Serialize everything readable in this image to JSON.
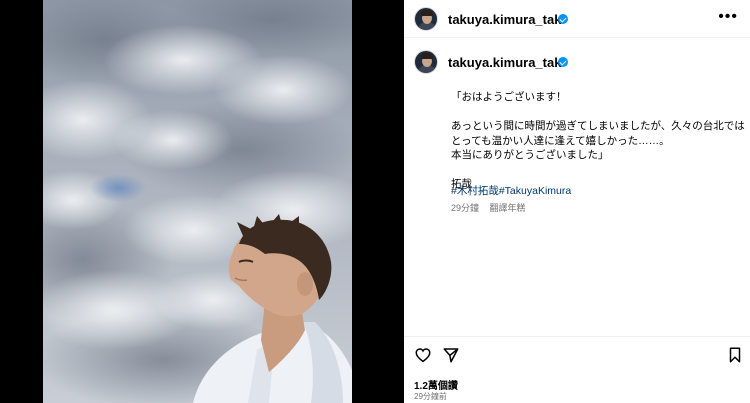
{
  "post": {
    "username": "takuya.kimura_tak",
    "verified": true,
    "more_icon": "more-horizontal-icon"
  },
  "caption": {
    "author": "takuya.kimura_tak",
    "lines": [
      "「おはようございます！",
      "",
      "あっという間に時間が過ぎてしまいましたが、久々の台北では",
      "とっても温かい人達に逢えて嬉しかった……。",
      "本当にありがとうございました」",
      "",
      "拓哉"
    ],
    "hashtags": "#木村拓哉#TakuyaKimura",
    "time_ago": "29分鐘",
    "translate_label": "翻譯年糕"
  },
  "actions": {
    "like_icon": "heart-icon",
    "share_icon": "send-icon",
    "save_icon": "bookmark-icon",
    "likes_text": "1.2萬個讚",
    "time_text": "29分鐘前"
  },
  "colors": {
    "verified": "#0095f6",
    "hashtag": "#00376b",
    "muted": "#737373",
    "backdrop": "#000000"
  }
}
